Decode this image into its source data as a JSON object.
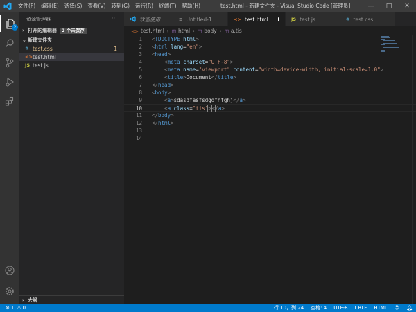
{
  "window": {
    "title": "test.html - 新建文件夹 - Visual Studio Code [管理员]",
    "menu": [
      "文件(F)",
      "编辑(E)",
      "选择(S)",
      "查看(V)",
      "转到(G)",
      "运行(R)",
      "终端(T)",
      "帮助(H)"
    ],
    "controls": {
      "minimize": "—",
      "maximize": "□",
      "close": "✕"
    }
  },
  "activity": {
    "explorer_badge": "2"
  },
  "sidebar": {
    "title": "资源管理器",
    "more": "···",
    "open_editors": {
      "label": "打开的编辑器",
      "unsaved": "2 个未保存",
      "chevron": "›"
    },
    "folder": {
      "label": "新建文件夹",
      "chevron": "⌄"
    },
    "files": [
      {
        "icon": "#",
        "name": "test.css",
        "count": "1"
      },
      {
        "icon": "<>",
        "name": "test.html"
      },
      {
        "icon": "JS",
        "name": "test.js"
      }
    ],
    "outline": {
      "label": "大纲",
      "chevron": "›"
    }
  },
  "tabs": [
    {
      "label": "欢迎使用",
      "icon": "vscode-icon"
    },
    {
      "label": "Untitled-1",
      "icon": "≡"
    },
    {
      "label": "test.html",
      "icon": "<>"
    },
    {
      "label": "test.js",
      "icon": "JS"
    },
    {
      "label": "test.css",
      "icon": "#"
    }
  ],
  "breadcrumb": {
    "items": [
      "test.html",
      "html",
      "body",
      "a.tis"
    ],
    "separator": "›"
  },
  "editor": {
    "line_numbers": [
      "1",
      "2",
      "3",
      "4",
      "5",
      "6",
      "7",
      "8",
      "9",
      "10",
      "11",
      "12",
      "13",
      "14"
    ],
    "current_line": 10,
    "lines": [
      "<!DOCTYPE html>",
      "<html lang=\"en\">",
      "<head>",
      "    <meta charset=\"UTF-8\">",
      "    <meta name=\"viewport\" content=\"width=device-width, initial-scale=1.0\">",
      "    <title>Document</title>",
      "</head>",
      "<body>",
      "    <a>sdasdfasfsdgdfhfghj</a>",
      "    <a class=\"tis\"></a>",
      "</body>",
      "</html>",
      "",
      ""
    ]
  },
  "statusbar": {
    "errors": "1",
    "warnings": "0",
    "position": "行 10，列 24",
    "spaces": "空格: 4",
    "encoding": "UTF-8",
    "eol": "CRLF",
    "language": "HTML"
  },
  "colors": {
    "accent": "#007acc",
    "tag": "#569cd6",
    "attribute": "#9cdcfe",
    "string": "#ce9178"
  }
}
